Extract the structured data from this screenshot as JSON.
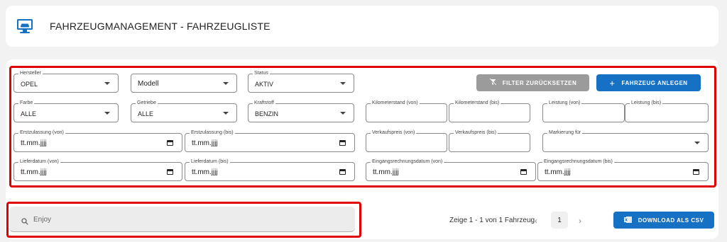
{
  "header": {
    "title": "FAHRZEUGMANAGEMENT - FAHRZEUGLISTE",
    "icon": "monitor-car-icon"
  },
  "filters": {
    "hersteller": {
      "label": "Hersteller",
      "value": "OPEL"
    },
    "modell": {
      "label": "",
      "placeholder": "Modell"
    },
    "status": {
      "label": "Status",
      "value": "AKTIV"
    },
    "farbe": {
      "label": "Farbe",
      "value": "ALLE"
    },
    "getriebe": {
      "label": "Getriebe",
      "value": "ALLE"
    },
    "kraftstoff": {
      "label": "Kraftstoff",
      "value": "BENZIN"
    },
    "km_von": {
      "label": "Kilometerstand (von)"
    },
    "km_bis": {
      "label": "Kilometerstand (bis)"
    },
    "leistung_von": {
      "label": "Leistung (von)"
    },
    "leistung_bis": {
      "label": "Leistung (bis)"
    },
    "ez_von": {
      "label": "Erstzulassung (von)",
      "placeholder": "tt.mm.jjjj"
    },
    "ez_bis": {
      "label": "Erstzulassung (bis)",
      "placeholder": "tt.mm.jjjj"
    },
    "vk_von": {
      "label": "Verkaufspreis (von)"
    },
    "vk_bis": {
      "label": "Verkaufspreis (bis)"
    },
    "markierung": {
      "label": "Markierung für"
    },
    "lieferdatum_von": {
      "label": "Lieferdatum (von)",
      "placeholder": "tt.mm.jjjj"
    },
    "lieferdatum_bis": {
      "label": "Lieferdatum (bis)",
      "placeholder": "tt.mm.jjjj"
    },
    "eingang_von": {
      "label": "Eingangsrechnungsdatum (von)",
      "placeholder": "tt.mm.jjjj"
    },
    "eingang_bis": {
      "label": "Eingangsrechnungsdatum (bis)",
      "placeholder": "tt.mm.jjjj"
    }
  },
  "buttons": {
    "reset_filter": "FILTER ZURÜCKSETZEN",
    "add_vehicle": "FAHRZEUG ANLEGEN",
    "download_csv": "DOWNLOAD ALS CSV"
  },
  "search": {
    "value": "Enjoy"
  },
  "pagination": {
    "summary": "Zeige 1 - 1 von 1 Fahrzeug",
    "current_page": "1",
    "prev": "‹",
    "next": "›"
  },
  "colors": {
    "primary": "#1670c4",
    "highlight": "#e00000",
    "disabled": "#9b9b9b"
  }
}
